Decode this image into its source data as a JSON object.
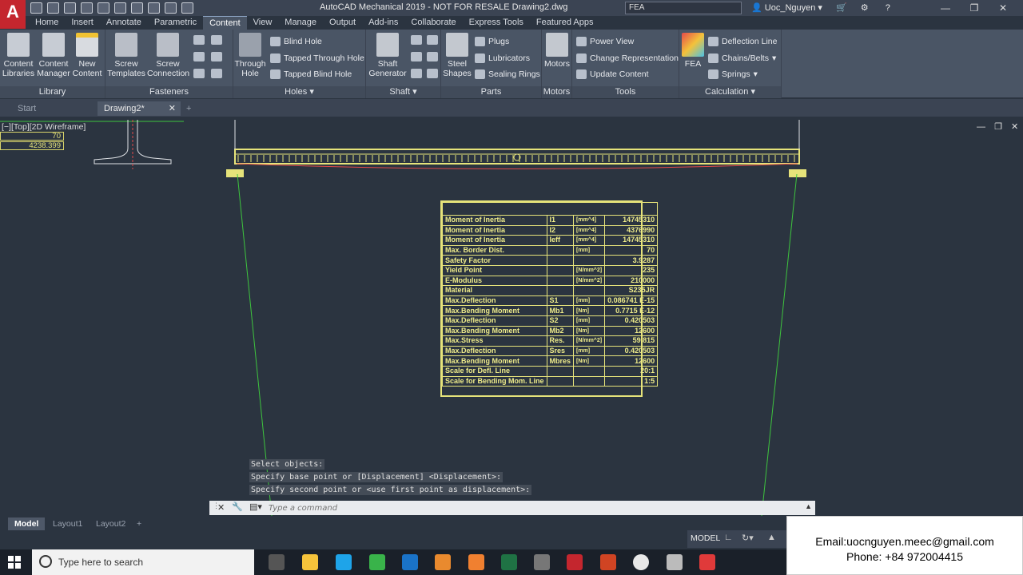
{
  "titlebar": {
    "app_logo": "A",
    "title": "AutoCAD Mechanical 2019 - NOT FOR RESALE    Drawing2.dwg",
    "search": "FEA",
    "user": "Uoc_Nguyen"
  },
  "ribbon_tabs": [
    "Home",
    "Insert",
    "Annotate",
    "Parametric",
    "Content",
    "View",
    "Manage",
    "Output",
    "Add-ins",
    "Collaborate",
    "Express Tools",
    "Featured Apps"
  ],
  "panels": {
    "library": {
      "title": "Library",
      "buttons": [
        {
          "label": "Content Libraries",
          "icon": "content-libraries-icon"
        },
        {
          "label": "Content Manager",
          "icon": "content-manager-icon"
        },
        {
          "label": "New Content",
          "icon": "new-content-icon"
        }
      ]
    },
    "fasteners": {
      "title": "Fasteners",
      "buttons": [
        {
          "label": "Screw Templates"
        },
        {
          "label": "Screw Connection"
        }
      ]
    },
    "holes": {
      "title": "Holes",
      "big": "Through Hole",
      "small": [
        "Blind Hole",
        "Tapped Through Hole",
        "Tapped Blind Hole"
      ]
    },
    "shaft": {
      "title": "Shaft",
      "big": "Shaft Generator"
    },
    "parts": {
      "title": "Parts",
      "big": "Steel Shapes",
      "small": [
        "Plugs",
        "Lubricators",
        "Sealing Rings"
      ]
    },
    "motors": {
      "title": "Motors",
      "big": "Motors"
    },
    "tools": {
      "title": "Tools",
      "small": [
        "Power View",
        "Change Representation",
        "Update Content"
      ]
    },
    "calculation": {
      "title": "Calculation",
      "big": "FEA",
      "small": [
        "Deflection Line",
        "Chains/Belts",
        "Springs"
      ]
    }
  },
  "doc_tabs": [
    "Start",
    "Drawing2*"
  ],
  "viewport_label": "[−][Top][2D Wireframe]",
  "viewport_values": [
    "70",
    "4238.399"
  ],
  "results_table": [
    [
      "Moment of Inertia",
      "I1",
      "[mm^4]",
      "14745310"
    ],
    [
      "Moment of Inertia",
      "I2",
      "[mm^4]",
      "4376990"
    ],
    [
      "Moment of Inertia",
      "Ieff",
      "[mm^4]",
      "14745310"
    ],
    [
      "Max. Border Dist.",
      "",
      "[mm]",
      "70"
    ],
    [
      "Safety Factor",
      "",
      "",
      "3.9287"
    ],
    [
      "Yield Point",
      "",
      "[N/mm^2]",
      "235"
    ],
    [
      "E-Modulus",
      "",
      "[N/mm^2]",
      "210000"
    ],
    [
      "Material",
      "",
      "",
      "S235JR"
    ],
    [
      "Max.Deflection",
      "S1",
      "[mm]",
      "0.086741 E-15"
    ],
    [
      "Max.Bending Moment",
      "Mb1",
      "[Nm]",
      "0.7715 E-12"
    ],
    [
      "Max.Deflection",
      "S2",
      "[mm]",
      "0.420503"
    ],
    [
      "Max.Bending Moment",
      "Mb2",
      "[Nm]",
      "12600"
    ],
    [
      "Max.Stress",
      "Res.",
      "[N/mm^2]",
      "59.815"
    ],
    [
      "Max.Deflection",
      "Sres",
      "[mm]",
      "0.420503"
    ],
    [
      "Max.Bending Moment",
      "Mbres",
      "[Nm]",
      "12600"
    ],
    [
      "Scale for Defl. Line",
      "",
      "",
      "20:1"
    ],
    [
      "Scale for Bending Mom. Line",
      "",
      "",
      "1:5"
    ]
  ],
  "command_history": [
    "Select objects:",
    "Specify base point or [Displacement] <Displacement>:",
    "Specify second point or <use first point as displacement>:"
  ],
  "command_placeholder": "Type a command",
  "layout_tabs": [
    "Model",
    "Layout1",
    "Layout2"
  ],
  "status": {
    "model": "MODEL"
  },
  "contact": {
    "email": "Email:uocnguyen.meec@gmail.com",
    "phone": "Phone: +84 972004415"
  },
  "taskbar": {
    "search_placeholder": "Type here to search"
  },
  "colors": {
    "accent": "#c4262e",
    "drawing_yellow": "#e6e37a",
    "drawing_green": "#3ec43e",
    "canvas": "#2b3440"
  }
}
